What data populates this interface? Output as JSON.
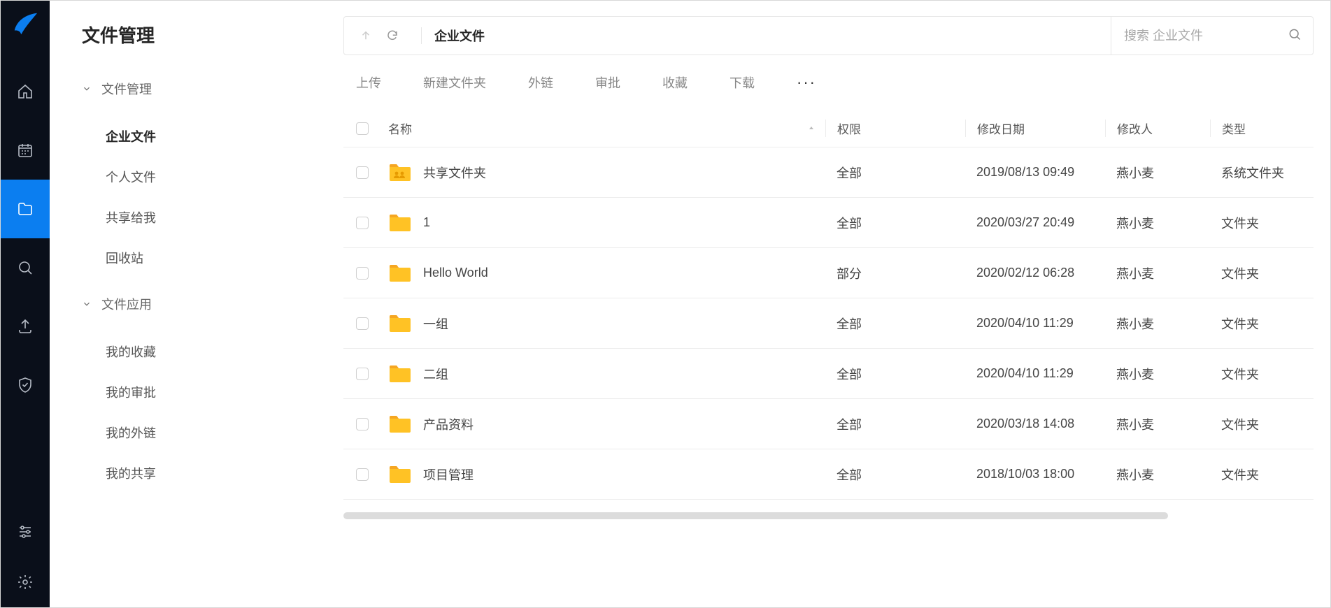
{
  "sidenav": {
    "title": "文件管理",
    "groups": [
      {
        "label": "文件管理",
        "items": [
          {
            "label": "企业文件",
            "active": true
          },
          {
            "label": "个人文件"
          },
          {
            "label": "共享给我"
          },
          {
            "label": "回收站"
          }
        ]
      },
      {
        "label": "文件应用",
        "items": [
          {
            "label": "我的收藏"
          },
          {
            "label": "我的审批"
          },
          {
            "label": "我的外链"
          },
          {
            "label": "我的共享"
          }
        ]
      }
    ]
  },
  "topbar": {
    "crumb": "企业文件",
    "search_placeholder": "搜索 企业文件"
  },
  "toolbar": {
    "items": [
      "上传",
      "新建文件夹",
      "外链",
      "审批",
      "收藏",
      "下载"
    ]
  },
  "table": {
    "headers": {
      "name": "名称",
      "perm": "权限",
      "date": "修改日期",
      "user": "修改人",
      "type": "类型"
    },
    "rows": [
      {
        "name": "共享文件夹",
        "perm": "全部",
        "date": "2019/08/13 09:49",
        "user": "燕小麦",
        "type": "系统文件夹",
        "icon": "shared"
      },
      {
        "name": "1",
        "perm": "全部",
        "date": "2020/03/27 20:49",
        "user": "燕小麦",
        "type": "文件夹",
        "icon": "folder"
      },
      {
        "name": "Hello World",
        "perm": "部分",
        "date": "2020/02/12 06:28",
        "user": "燕小麦",
        "type": "文件夹",
        "icon": "folder"
      },
      {
        "name": "一组",
        "perm": "全部",
        "date": "2020/04/10 11:29",
        "user": "燕小麦",
        "type": "文件夹",
        "icon": "folder"
      },
      {
        "name": "二组",
        "perm": "全部",
        "date": "2020/04/10 11:29",
        "user": "燕小麦",
        "type": "文件夹",
        "icon": "folder"
      },
      {
        "name": "产品资料",
        "perm": "全部",
        "date": "2020/03/18 14:08",
        "user": "燕小麦",
        "type": "文件夹",
        "icon": "folder"
      },
      {
        "name": "项目管理",
        "perm": "全部",
        "date": "2018/10/03 18:00",
        "user": "燕小麦",
        "type": "文件夹",
        "icon": "folder"
      }
    ]
  }
}
